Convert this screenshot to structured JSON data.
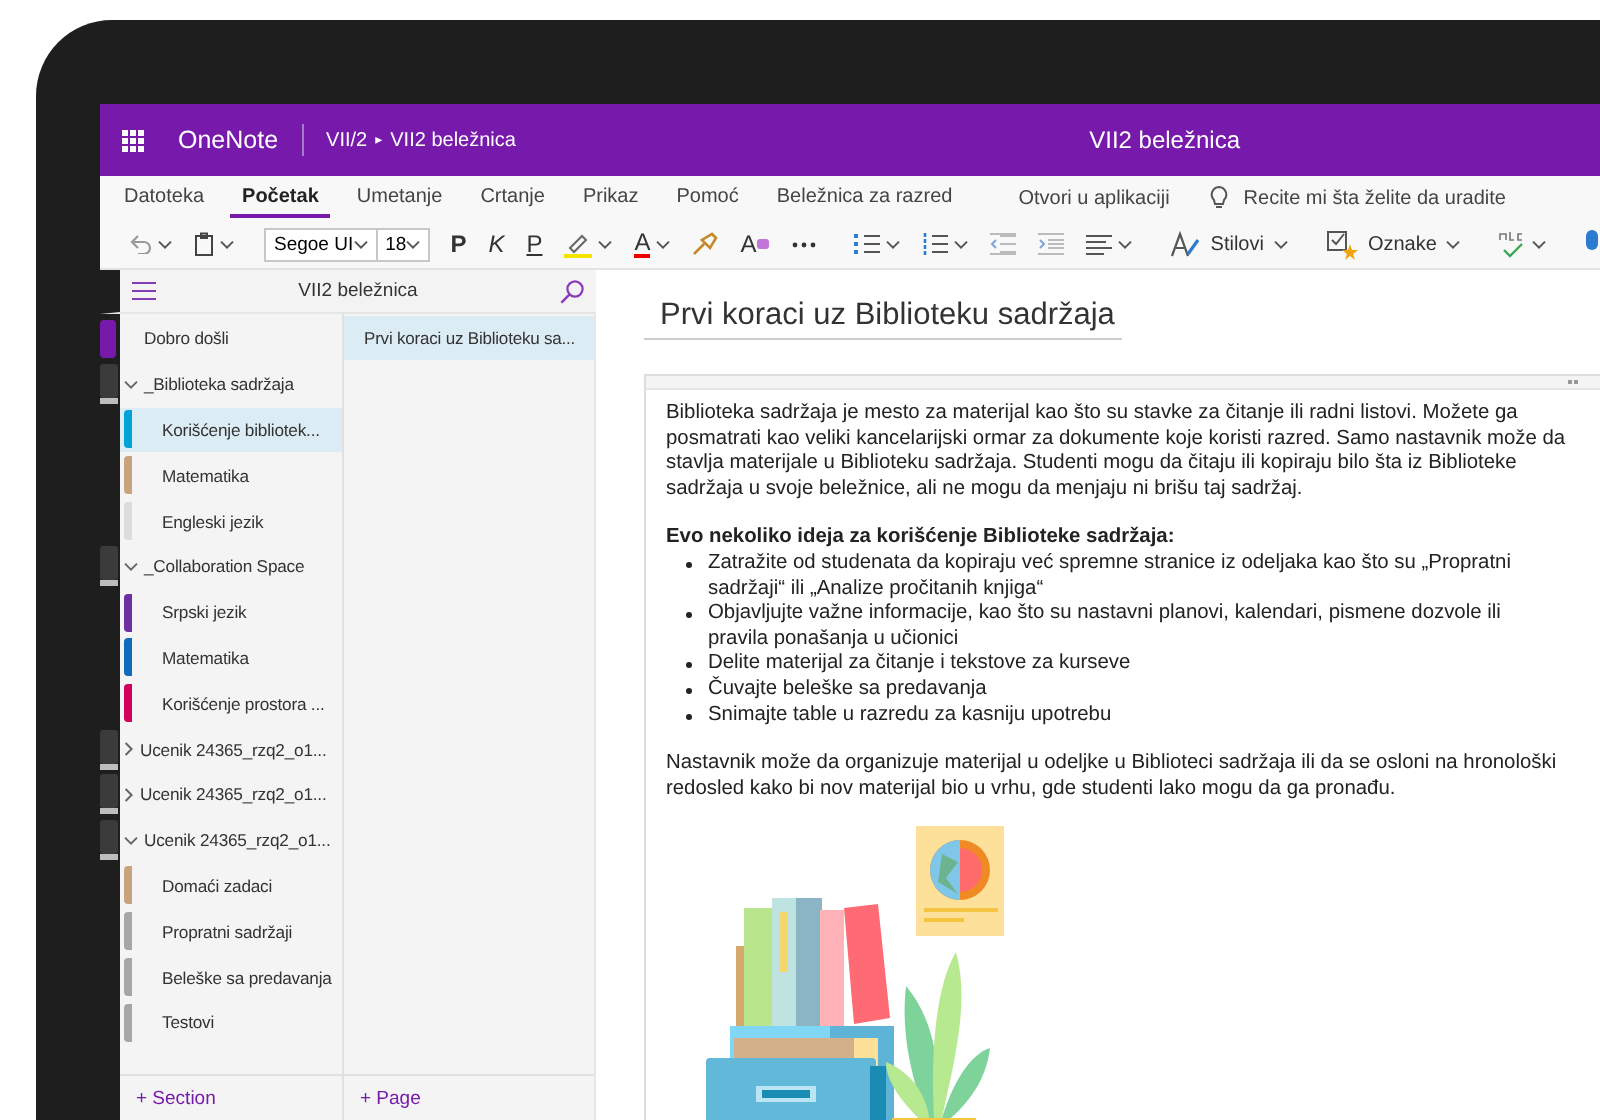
{
  "title_bar": {
    "app_name": "OneNote",
    "breadcrumb_parent": "VII/2",
    "breadcrumb_separator": "▸",
    "breadcrumb_current": "VII2 beležnica",
    "document_title": "VII2 beležnica"
  },
  "ribbon_tabs": [
    {
      "label": "Datoteka",
      "selected": false
    },
    {
      "label": "Početak",
      "selected": true
    },
    {
      "label": "Umetanje",
      "selected": false
    },
    {
      "label": "Crtanje",
      "selected": false
    },
    {
      "label": "Prikaz",
      "selected": false
    },
    {
      "label": "Pomoć",
      "selected": false
    },
    {
      "label": "Beležnica za razred",
      "selected": false
    }
  ],
  "open_in_app": "Otvori u aplikaciji",
  "tell_me": {
    "placeholder": "Recite mi šta želite da uradite"
  },
  "toolbar": {
    "font_name": "Segoe UI",
    "font_size": "18",
    "bold": "P",
    "italic": "K",
    "underline": "P",
    "text_color": "A",
    "clear_format": "A",
    "styles": "Stilovi",
    "tags": "Oznake"
  },
  "notebook": {
    "title": "VII2 beležnica",
    "add_section": "+ Section",
    "sections": [
      {
        "kind": "section",
        "name": "Dobro došli",
        "color": "#7719aa",
        "selected": false
      },
      {
        "kind": "group",
        "name": "_Biblioteka sadržaja",
        "expanded": true,
        "children": [
          {
            "kind": "section",
            "name": "Korišćenje bibliotek...",
            "color": "#00a2d7",
            "selected": true
          },
          {
            "kind": "section",
            "name": "Matematika",
            "color": "#c8a47e",
            "selected": false
          },
          {
            "kind": "section",
            "name": "Engleski jezik",
            "color": "#dcdcdc",
            "selected": false
          }
        ]
      },
      {
        "kind": "group",
        "name": "_Collaboration Space",
        "expanded": true,
        "children": [
          {
            "kind": "section",
            "name": "Srpski jezik",
            "color": "#6b2fa0",
            "selected": false
          },
          {
            "kind": "section",
            "name": "Matematika",
            "color": "#0f6cbd",
            "selected": false
          },
          {
            "kind": "section",
            "name": "Korišćenje prostora ...",
            "color": "#d0005b",
            "selected": false
          }
        ]
      },
      {
        "kind": "group",
        "name": "Ucenik 24365_rzq2_o1...",
        "expanded": false
      },
      {
        "kind": "group",
        "name": "Ucenik 24365_rzq2_o1...",
        "expanded": false
      },
      {
        "kind": "group",
        "name": "Ucenik 24365_rzq2_o1...",
        "expanded": true,
        "children": [
          {
            "kind": "section",
            "name": "Domaći zadaci",
            "color": "#c8a47e",
            "selected": false
          },
          {
            "kind": "section",
            "name": "Propratni sadržaji",
            "color": "#a6a6a6",
            "selected": false
          },
          {
            "kind": "section",
            "name": "Beleške sa predavanja",
            "color": "#a6a6a6",
            "selected": false
          },
          {
            "kind": "section",
            "name": "Testovi",
            "color": "#a6a6a6",
            "selected": false
          }
        ]
      }
    ]
  },
  "pages": {
    "add_page": "+ Page",
    "items": [
      {
        "title": "Prvi koraci uz Biblioteku sa...",
        "selected": true
      }
    ]
  },
  "page": {
    "title": "Prvi koraci uz Biblioteku sadržaja",
    "intro": "Biblioteka sadržaja je mesto za materijal kao što su stavke za čitanje ili radni listovi. Možete ga posmatrati kao veliki kancelarijski ormar za dokumente koje koristi razred. Samo nastavnik može da stavlja materijale u Biblioteku sadržaja. Studenti mogu da čitaju ili kopiraju bilo šta iz Biblioteke sadržaja u svoje beležnice, ali ne mogu da menjaju ni brišu taj sadržaj.",
    "ideas_heading": "Evo nekoliko ideja za korišćenje Biblioteke sadržaja:",
    "ideas": [
      "Zatražite od studenata da kopiraju već spremne stranice iz odeljaka kao što su „Propratni sadržaji“ ili „Analize pročitanih knjiga“",
      "Objavljujte važne informacije, kao što su nastavni planovi, kalendari, pismene dozvole ili pravila ponašanja u učionici",
      "Delite materijal za čitanje i tekstove za kurseve",
      "Čuvajte beleške sa predavanja",
      "Snimajte table u razredu za kasniju upotrebu"
    ],
    "closing": "Nastavnik može da organizuje materijal u odeljke u Biblioteci sadržaja ili da se osloni na hronološki redosled kako bi nov materijal bio u vrhu, gde studenti lako mogu da ga pronađu."
  }
}
